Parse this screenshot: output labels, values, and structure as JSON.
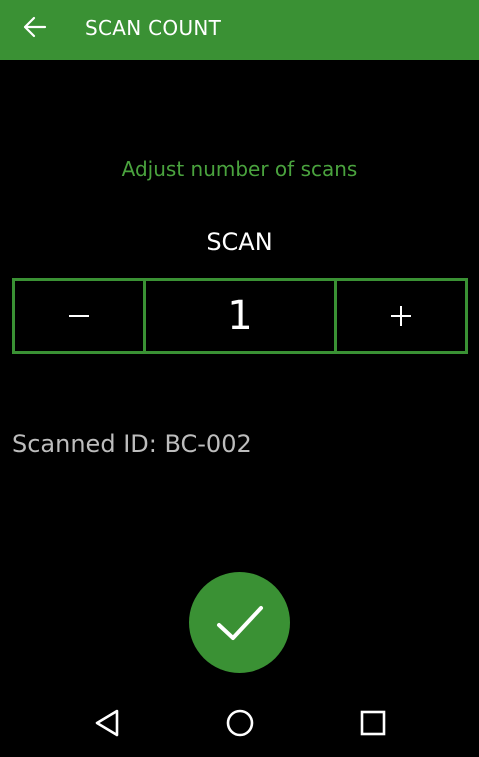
{
  "app_bar": {
    "title": "SCAN COUNT",
    "back_icon": "arrow-left-icon"
  },
  "main": {
    "hint": "Adjust number of scans",
    "stepper": {
      "label": "SCAN",
      "value": "1",
      "decrement_icon": "minus-icon",
      "increment_icon": "plus-icon"
    },
    "scanned_id": "Scanned ID: BC-002"
  },
  "confirm": {
    "icon": "check-icon"
  },
  "nav_bar": {
    "back_icon": "triangle-back-icon",
    "home_icon": "circle-home-icon",
    "recents_icon": "square-recents-icon"
  },
  "colors": {
    "accent": "#3a9134",
    "hint_text": "#4aa33e",
    "background": "#000000",
    "secondary_text": "#bdbdbd"
  }
}
